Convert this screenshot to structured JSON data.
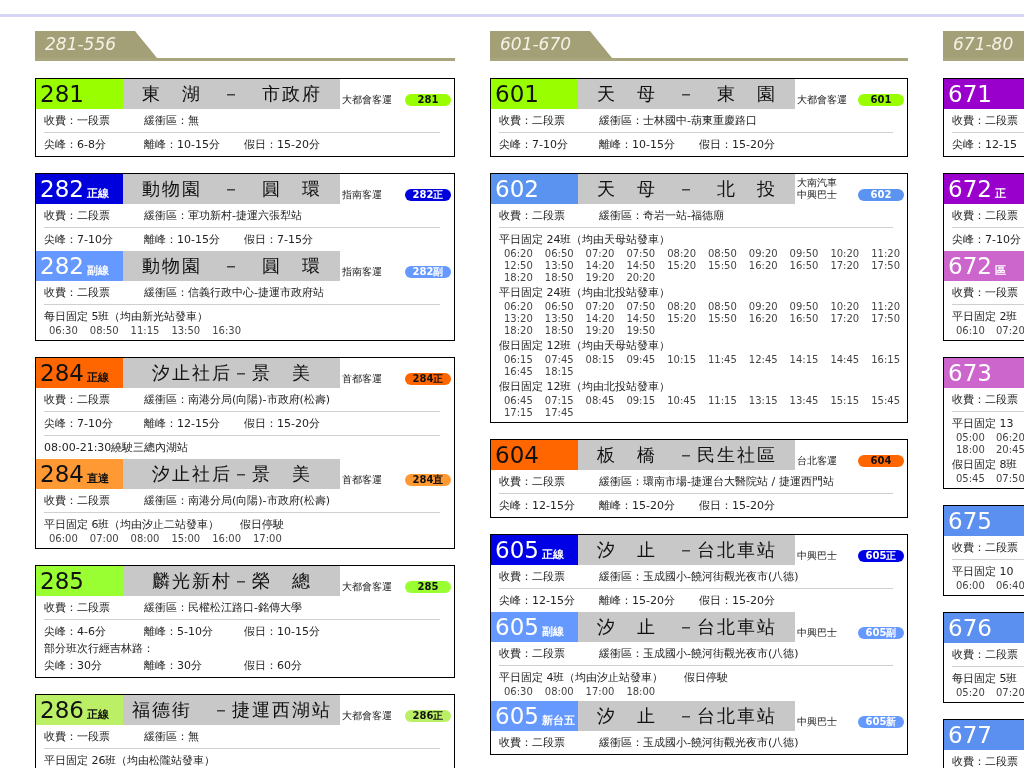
{
  "columns": [
    {
      "label": "281-556",
      "cards": [
        {
          "sections": [
            {
              "number": "281",
              "color": "#99ff00",
              "name": "東　湖　－　市政府",
              "operators": [
                "大都會客運"
              ],
              "badge": "281",
              "rows": [
                {
                  "lines": [
                    {
                      "kind": "text",
                      "items": [
                        "收費：一段票",
                        "緩衝區：無"
                      ]
                    }
                  ]
                },
                {
                  "lines": [
                    {
                      "kind": "text",
                      "items": [
                        "尖峰：6-8分",
                        "離峰：10-15分",
                        "假日：15-20分"
                      ]
                    }
                  ]
                }
              ]
            }
          ]
        },
        {
          "sections": [
            {
              "number": "282",
              "variant": "正線",
              "color": "#0000dd",
              "name": "動物園　－　圓　環",
              "operators": [
                "指南客運"
              ],
              "badge": "282正",
              "rows": [
                {
                  "lines": [
                    {
                      "kind": "text",
                      "items": [
                        "收費：二段票",
                        "緩衝區：軍功新村-捷運六張犁站"
                      ]
                    }
                  ]
                },
                {
                  "lines": [
                    {
                      "kind": "text",
                      "items": [
                        "尖峰：7-10分",
                        "離峰：10-15分",
                        "假日：7-15分"
                      ]
                    }
                  ]
                }
              ]
            },
            {
              "number": "282",
              "variant": "副線",
              "color": "#6699ff",
              "name": "動物園　－　圓　環",
              "operators": [
                "指南客運"
              ],
              "badge": "282副",
              "rows": [
                {
                  "lines": [
                    {
                      "kind": "text",
                      "items": [
                        "收費：二段票",
                        "緩衝區：信義行政中心-捷運市政府站"
                      ]
                    }
                  ]
                },
                {
                  "lines": [
                    {
                      "kind": "text",
                      "items": [
                        "每日固定 5班（均由新光站發車）"
                      ]
                    },
                    {
                      "kind": "times",
                      "items": [
                        "06:30",
                        "08:50",
                        "11:15",
                        "13:50",
                        "16:30"
                      ]
                    }
                  ]
                }
              ]
            }
          ]
        },
        {
          "sections": [
            {
              "number": "284",
              "variant": "正線",
              "color": "#ff6600",
              "name": "汐止社后－景　美",
              "operators": [
                "首都客運"
              ],
              "badge": "284正",
              "rows": [
                {
                  "lines": [
                    {
                      "kind": "text",
                      "items": [
                        "收費：二段票",
                        "緩衝區：南港分局(向陽)-市政府(松壽)"
                      ]
                    }
                  ]
                },
                {
                  "lines": [
                    {
                      "kind": "text",
                      "items": [
                        "尖峰：7-10分",
                        "離峰：12-15分",
                        "假日：15-20分"
                      ]
                    }
                  ]
                },
                {
                  "lines": [
                    {
                      "kind": "text",
                      "items": [
                        "08:00-21:30繞駛三總內湖站"
                      ]
                    }
                  ]
                }
              ]
            },
            {
              "number": "284",
              "variant": "直達",
              "color": "#ff9933",
              "name": "汐止社后－景　美",
              "operators": [
                "首都客運"
              ],
              "badge": "284直",
              "rows": [
                {
                  "lines": [
                    {
                      "kind": "text",
                      "items": [
                        "收費：二段票",
                        "緩衝區：南港分局(向陽)-市政府(松壽)"
                      ]
                    }
                  ]
                },
                {
                  "lines": [
                    {
                      "kind": "text",
                      "items": [
                        "平日固定 6班（均由汐止二站發車）",
                        "假日停駛"
                      ]
                    },
                    {
                      "kind": "times",
                      "items": [
                        "06:00",
                        "07:00",
                        "08:00",
                        "15:00",
                        "16:00",
                        "17:00"
                      ]
                    }
                  ]
                }
              ]
            }
          ]
        },
        {
          "sections": [
            {
              "number": "285",
              "color": "#99ff33",
              "name": "麟光新村－榮　總",
              "operators": [
                "大都會客運"
              ],
              "badge": "285",
              "rows": [
                {
                  "lines": [
                    {
                      "kind": "text",
                      "items": [
                        "收費：二段票",
                        "緩衝區：民權松江路口-銘傳大學"
                      ]
                    }
                  ]
                },
                {
                  "lines": [
                    {
                      "kind": "text",
                      "items": [
                        "尖峰：4-6分",
                        "離峰：5-10分",
                        "假日：10-15分"
                      ]
                    },
                    {
                      "kind": "text",
                      "items": [
                        "部分班次行經吉林路："
                      ]
                    },
                    {
                      "kind": "text",
                      "items": [
                        "尖峰：30分",
                        "離峰：30分",
                        "假日：60分"
                      ]
                    }
                  ]
                }
              ]
            }
          ]
        },
        {
          "sections": [
            {
              "number": "286",
              "variant": "正線",
              "color": "#bbf066",
              "name": "福德街　－捷運西湖站",
              "operators": [
                "大都會客運"
              ],
              "badge": "286正",
              "rows": [
                {
                  "lines": [
                    {
                      "kind": "text",
                      "items": [
                        "收費：一段票",
                        "緩衝區：無"
                      ]
                    }
                  ]
                },
                {
                  "lines": [
                    {
                      "kind": "text",
                      "items": [
                        "平日固定 26班（均由松隴站發車）"
                      ]
                    }
                  ]
                }
              ]
            }
          ]
        }
      ]
    },
    {
      "label": "601-670",
      "cards": [
        {
          "sections": [
            {
              "number": "601",
              "color": "#99ff00",
              "name": "天　母　－　東　園",
              "operators": [
                "大都會客運"
              ],
              "badge": "601",
              "rows": [
                {
                  "lines": [
                    {
                      "kind": "text",
                      "items": [
                        "收費：二段票",
                        "緩衝區：士林國中-葫東重慶路口"
                      ]
                    }
                  ]
                },
                {
                  "lines": [
                    {
                      "kind": "text",
                      "items": [
                        "尖峰：7-10分",
                        "離峰：10-15分",
                        "假日：15-20分"
                      ]
                    }
                  ]
                }
              ]
            }
          ]
        },
        {
          "sections": [
            {
              "number": "602",
              "color": "#5b94f0",
              "name": "天　母　－　北　投",
              "operators": [
                "大南汽車",
                "中興巴士"
              ],
              "badge": "602",
              "rows": [
                {
                  "lines": [
                    {
                      "kind": "text",
                      "items": [
                        "收費：二段票",
                        "緩衝區：奇岩一站-福德廟"
                      ]
                    }
                  ]
                },
                {
                  "lines": [
                    {
                      "kind": "text",
                      "items": [
                        "平日固定 24班（均由天母站發車）"
                      ]
                    },
                    {
                      "kind": "times",
                      "items": [
                        "06:20",
                        "06:50",
                        "07:20",
                        "07:50",
                        "08:20",
                        "08:50",
                        "09:20",
                        "09:50",
                        "10:20",
                        "11:20"
                      ]
                    },
                    {
                      "kind": "times",
                      "items": [
                        "12:50",
                        "13:50",
                        "14:20",
                        "14:50",
                        "15:20",
                        "15:50",
                        "16:20",
                        "16:50",
                        "17:20",
                        "17:50"
                      ]
                    },
                    {
                      "kind": "times",
                      "items": [
                        "18:20",
                        "18:50",
                        "19:20",
                        "20:20"
                      ]
                    },
                    {
                      "kind": "text",
                      "items": [
                        "平日固定 24班（均由北投站發車）"
                      ]
                    },
                    {
                      "kind": "times",
                      "items": [
                        "06:20",
                        "06:50",
                        "07:20",
                        "07:50",
                        "08:20",
                        "08:50",
                        "09:20",
                        "09:50",
                        "10:20",
                        "11:20"
                      ]
                    },
                    {
                      "kind": "times",
                      "items": [
                        "13:20",
                        "13:50",
                        "14:20",
                        "14:50",
                        "15:20",
                        "15:50",
                        "16:20",
                        "16:50",
                        "17:20",
                        "17:50"
                      ]
                    },
                    {
                      "kind": "times",
                      "items": [
                        "18:20",
                        "18:50",
                        "19:20",
                        "19:50"
                      ]
                    },
                    {
                      "kind": "text",
                      "items": [
                        "假日固定 12班（均由天母站發車）"
                      ]
                    },
                    {
                      "kind": "times",
                      "items": [
                        "06:15",
                        "07:45",
                        "08:15",
                        "09:45",
                        "10:15",
                        "11:45",
                        "12:45",
                        "14:15",
                        "14:45",
                        "16:15"
                      ]
                    },
                    {
                      "kind": "times",
                      "items": [
                        "16:45",
                        "18:15"
                      ]
                    },
                    {
                      "kind": "text",
                      "items": [
                        "假日固定 12班（均由北投站發車）"
                      ]
                    },
                    {
                      "kind": "times",
                      "items": [
                        "06:45",
                        "07:15",
                        "08:45",
                        "09:15",
                        "10:45",
                        "11:15",
                        "13:15",
                        "13:45",
                        "15:15",
                        "15:45"
                      ]
                    },
                    {
                      "kind": "times",
                      "items": [
                        "17:15",
                        "17:45"
                      ]
                    }
                  ]
                }
              ]
            }
          ]
        },
        {
          "sections": [
            {
              "number": "604",
              "color": "#ff6600",
              "name": "板　橋　－民生社區",
              "operators": [
                "台北客運"
              ],
              "badge": "604",
              "rows": [
                {
                  "lines": [
                    {
                      "kind": "text",
                      "items": [
                        "收費：二段票",
                        "緩衝區：環南市場-捷運台大醫院站 / 捷運西門站"
                      ]
                    }
                  ]
                },
                {
                  "lines": [
                    {
                      "kind": "text",
                      "items": [
                        "尖峰：12-15分",
                        "離峰：15-20分",
                        "假日：15-20分"
                      ]
                    }
                  ]
                }
              ]
            }
          ]
        },
        {
          "sections": [
            {
              "number": "605",
              "variant": "正線",
              "color": "#0000e6",
              "name": "汐　止　－台北車站",
              "operators": [
                "中興巴士"
              ],
              "badge": "605正",
              "rows": [
                {
                  "lines": [
                    {
                      "kind": "text",
                      "items": [
                        "收費：二段票",
                        "緩衝區：玉成國小-饒河街觀光夜市(八德)"
                      ]
                    }
                  ]
                },
                {
                  "lines": [
                    {
                      "kind": "text",
                      "items": [
                        "尖峰：12-15分",
                        "離峰：15-20分",
                        "假日：15-20分"
                      ]
                    }
                  ]
                }
              ]
            },
            {
              "number": "605",
              "variant": "副線",
              "color": "#6699ff",
              "name": "汐　止　－台北車站",
              "operators": [
                "中興巴士"
              ],
              "badge": "605副",
              "rows": [
                {
                  "lines": [
                    {
                      "kind": "text",
                      "items": [
                        "收費：二段票",
                        "緩衝區：玉成國小-饒河街觀光夜市(八德)"
                      ]
                    }
                  ]
                },
                {
                  "lines": [
                    {
                      "kind": "text",
                      "items": [
                        "平日固定 4班（均由汐止站發車）",
                        "假日停駛"
                      ]
                    },
                    {
                      "kind": "times",
                      "items": [
                        "06:30",
                        "08:00",
                        "17:00",
                        "18:00"
                      ]
                    }
                  ]
                }
              ]
            },
            {
              "number": "605",
              "variant": "新台五",
              "color": "#6699ff",
              "name": "汐　止　－台北車站",
              "operators": [
                "中興巴士"
              ],
              "badge": "605新",
              "rows": [
                {
                  "lines": [
                    {
                      "kind": "text",
                      "items": [
                        "收費：二段票",
                        "緩衝區：玉成國小-饒河街觀光夜市(八德)"
                      ]
                    }
                  ]
                }
              ]
            }
          ]
        }
      ]
    },
    {
      "label": "671-80",
      "cards": [
        {
          "sections": [
            {
              "number": "671",
              "color": "#9900cc",
              "rows": [
                {
                  "lines": [
                    {
                      "kind": "text",
                      "items": [
                        "收費：二段票"
                      ]
                    }
                  ]
                },
                {
                  "lines": [
                    {
                      "kind": "text",
                      "items": [
                        "尖峰：12-15"
                      ]
                    }
                  ]
                }
              ]
            }
          ]
        },
        {
          "sections": [
            {
              "number": "672",
              "variant": "正",
              "color": "#9900cc",
              "rows": [
                {
                  "lines": [
                    {
                      "kind": "text",
                      "items": [
                        "收費：二段票"
                      ]
                    }
                  ]
                },
                {
                  "lines": [
                    {
                      "kind": "text",
                      "items": [
                        "尖峰：7-10分"
                      ]
                    }
                  ]
                }
              ]
            },
            {
              "number": "672",
              "variant": "區",
              "color": "#cc66cc",
              "rows": [
                {
                  "lines": [
                    {
                      "kind": "text",
                      "items": [
                        "收費：一段票"
                      ]
                    }
                  ]
                },
                {
                  "lines": [
                    {
                      "kind": "text",
                      "items": [
                        "平日固定 2班"
                      ]
                    },
                    {
                      "kind": "times",
                      "items": [
                        "06:10",
                        "07:20"
                      ]
                    }
                  ]
                }
              ]
            }
          ]
        },
        {
          "sections": [
            {
              "number": "673",
              "color": "#cc66cc",
              "rows": [
                {
                  "lines": [
                    {
                      "kind": "text",
                      "items": [
                        "收費：二段票"
                      ]
                    }
                  ]
                },
                {
                  "lines": [
                    {
                      "kind": "text",
                      "items": [
                        "平日固定 13"
                      ]
                    },
                    {
                      "kind": "times",
                      "items": [
                        "05:00",
                        "06:20"
                      ]
                    },
                    {
                      "kind": "times",
                      "items": [
                        "18:00",
                        "20:45"
                      ]
                    },
                    {
                      "kind": "text",
                      "items": [
                        "假日固定 8班"
                      ]
                    },
                    {
                      "kind": "times",
                      "items": [
                        "05:45",
                        "07:50"
                      ]
                    }
                  ]
                }
              ]
            }
          ]
        },
        {
          "sections": [
            {
              "number": "675",
              "color": "#5b8ff0",
              "rows": [
                {
                  "lines": [
                    {
                      "kind": "text",
                      "items": [
                        "收費：二段票"
                      ]
                    }
                  ]
                },
                {
                  "lines": [
                    {
                      "kind": "text",
                      "items": [
                        "平日固定 10"
                      ]
                    },
                    {
                      "kind": "times",
                      "items": [
                        "06:00",
                        "06:40"
                      ]
                    }
                  ]
                }
              ]
            }
          ]
        },
        {
          "sections": [
            {
              "number": "676",
              "color": "#5b8ff0",
              "rows": [
                {
                  "lines": [
                    {
                      "kind": "text",
                      "items": [
                        "收費：二段票"
                      ]
                    }
                  ]
                },
                {
                  "lines": [
                    {
                      "kind": "text",
                      "items": [
                        "每日固定 5班"
                      ]
                    },
                    {
                      "kind": "times",
                      "items": [
                        "05:20",
                        "07:20"
                      ]
                    }
                  ]
                }
              ]
            }
          ]
        },
        {
          "sections": [
            {
              "number": "677",
              "color": "#5b8ff0",
              "rows": [
                {
                  "lines": [
                    {
                      "kind": "text",
                      "items": [
                        "收費：二段票"
                      ]
                    }
                  ]
                },
                {
                  "lines": []
                }
              ]
            }
          ]
        }
      ]
    }
  ]
}
